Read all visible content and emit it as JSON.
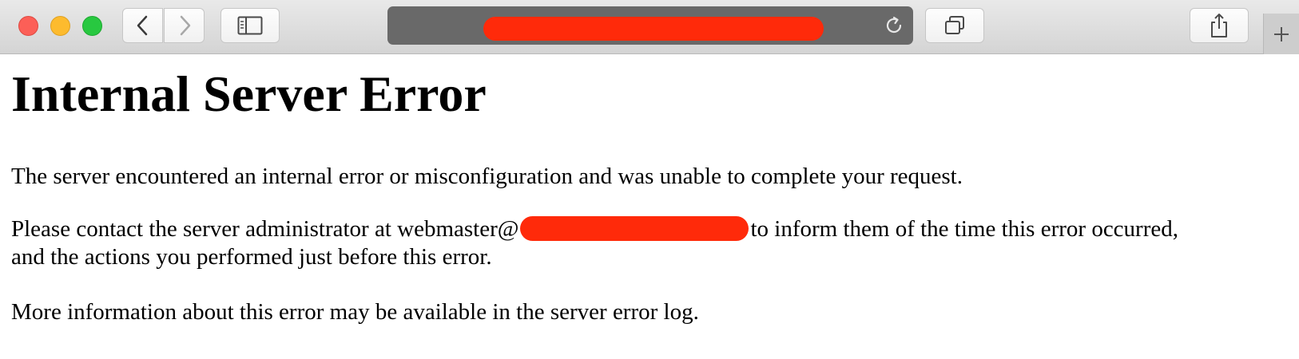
{
  "browser": {
    "buttons": {
      "back_icon": "chevron-left-icon",
      "forward_icon": "chevron-right-icon",
      "sidebar_icon": "sidebar-icon",
      "tabs_icon": "tab-overview-icon",
      "share_icon": "share-icon",
      "new_tab_icon": "plus-icon"
    },
    "address_bar": {
      "url": "",
      "reload_icon": "reload-icon"
    }
  },
  "page": {
    "title": "Internal Server Error",
    "paragraph1": "The server encountered an internal error or misconfiguration and was unable to complete your request.",
    "paragraph2_before": "Please contact the server administrator at webmaster@",
    "paragraph2_after": "to inform them of the time this error occurred,",
    "paragraph2_line2": "and the actions you performed just before this error.",
    "paragraph3": "More information about this error may be available in the server error log."
  },
  "colors": {
    "redaction": "#ff2a0a",
    "address_bar": "#696969",
    "close": "#fc5f57",
    "minimize": "#fdbb2e",
    "maximize": "#28c840"
  }
}
